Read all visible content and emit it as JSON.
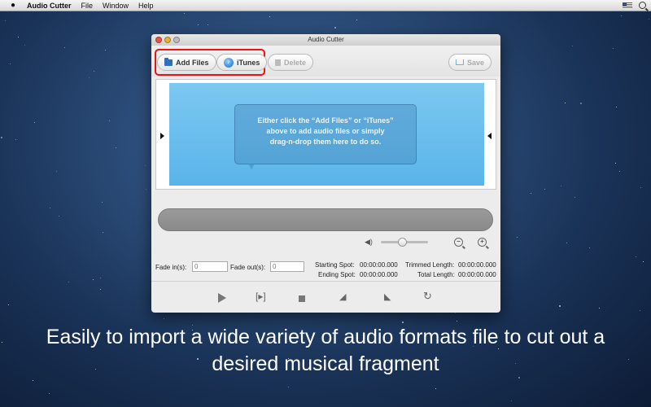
{
  "menubar": {
    "apple": "",
    "app_name": "Audio Cutter",
    "items": [
      "File",
      "Window",
      "Help"
    ]
  },
  "window": {
    "title": "Audio Cutter",
    "toolbar": {
      "add_files": "Add Files",
      "itunes": "iTunes",
      "delete": "Delete",
      "save": "Save"
    },
    "drop_zone": {
      "line1": "Either click the “Add Files” or “iTunes”",
      "line2": "above to add audio files or simply",
      "line3": "drag-n-drop them here to do so."
    },
    "volume_level": 0.45,
    "fade_in_label": "Fade in(s):",
    "fade_in_value": "0",
    "fade_out_label": "Fade out(s):",
    "fade_out_value": "0",
    "starting_spot_label": "Starting Spot:",
    "starting_spot_value": "00:00:00.000",
    "ending_spot_label": "Ending Spot:",
    "ending_spot_value": "00:00:00.000",
    "trimmed_length_label": "Trimmed Length:",
    "trimmed_length_value": "00:00:00.000",
    "total_length_label": "Total Length:",
    "total_length_value": "00:00:00.000"
  },
  "caption": {
    "line1": "Easily to import a wide variety of audio formats file to cut out a",
    "line2": "desired musical fragment"
  }
}
